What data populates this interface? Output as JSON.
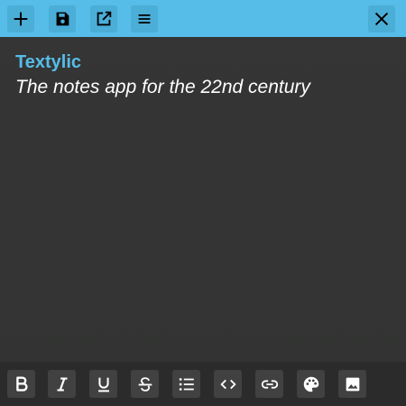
{
  "toolbar": {
    "buttons": [
      {
        "name": "new-note",
        "icon": "plus-icon"
      },
      {
        "name": "save",
        "icon": "floppy-disk-icon"
      },
      {
        "name": "open-external",
        "icon": "open-in-new-icon"
      },
      {
        "name": "menu",
        "icon": "hamburger-menu-icon"
      }
    ],
    "close_icon": "close-icon",
    "background": "#56bde8"
  },
  "note": {
    "title": "Textylic",
    "subtitle": "The notes app for the 22nd century",
    "title_color": "#56bde8"
  },
  "format_bar": {
    "buttons": [
      {
        "name": "bold",
        "icon": "bold-icon"
      },
      {
        "name": "italic",
        "icon": "italic-icon"
      },
      {
        "name": "underline",
        "icon": "underline-icon"
      },
      {
        "name": "strikethrough",
        "icon": "strikethrough-icon"
      },
      {
        "name": "bulleted-list",
        "icon": "list-icon"
      },
      {
        "name": "code",
        "icon": "code-icon"
      },
      {
        "name": "link",
        "icon": "link-icon"
      },
      {
        "name": "color",
        "icon": "palette-icon"
      },
      {
        "name": "image",
        "icon": "image-icon"
      }
    ]
  }
}
